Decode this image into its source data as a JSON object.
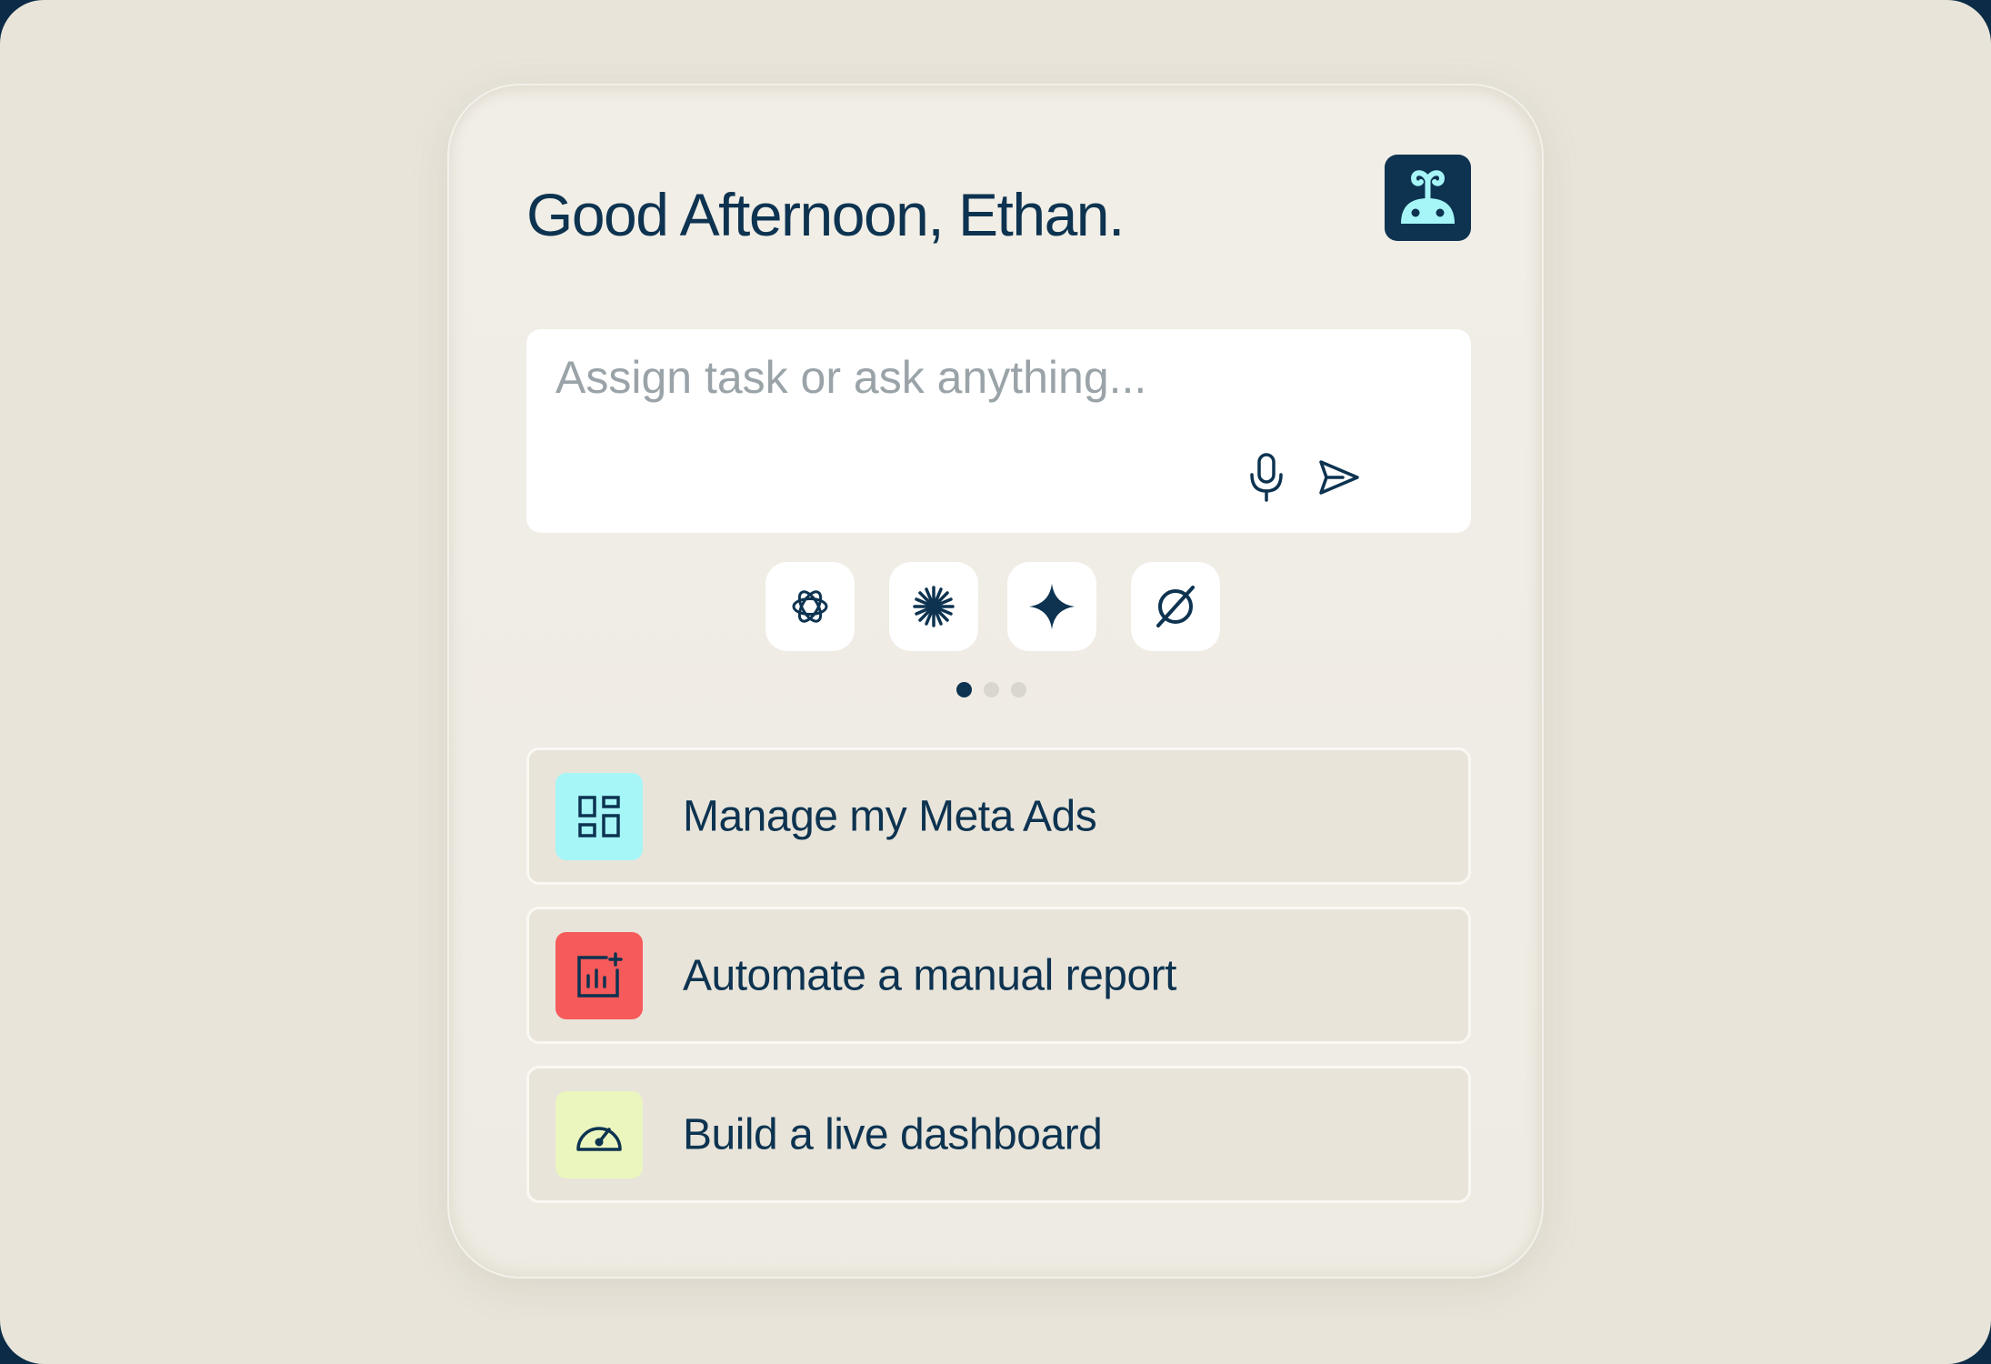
{
  "greeting": "Good Afternoon, Ethan.",
  "input": {
    "placeholder": "Assign task or ask anything...",
    "value": ""
  },
  "icons": {
    "logo": "whale-bot-icon",
    "mic": "microphone-icon",
    "send": "send-icon"
  },
  "models": [
    {
      "name": "openai-icon"
    },
    {
      "name": "asterisk-burst-icon"
    },
    {
      "name": "sparkle-star-icon"
    },
    {
      "name": "slashed-circle-icon"
    }
  ],
  "pagination": {
    "total": 3,
    "active": 1
  },
  "suggestions": [
    {
      "label": "Manage my Meta Ads",
      "icon": "dashboard-grid-icon",
      "icon_bg": "#a6f6f8"
    },
    {
      "label": "Automate a manual report",
      "icon": "bar-chart-add-icon",
      "icon_bg": "#f65a5a"
    },
    {
      "label": "Build a live dashboard",
      "icon": "speedometer-icon",
      "icon_bg": "#eaf6be"
    }
  ],
  "colors": {
    "primary": "#0d3350",
    "background": "#e8e4da",
    "card": "#f1eee7",
    "dot_inactive": "#d9d6cf"
  }
}
